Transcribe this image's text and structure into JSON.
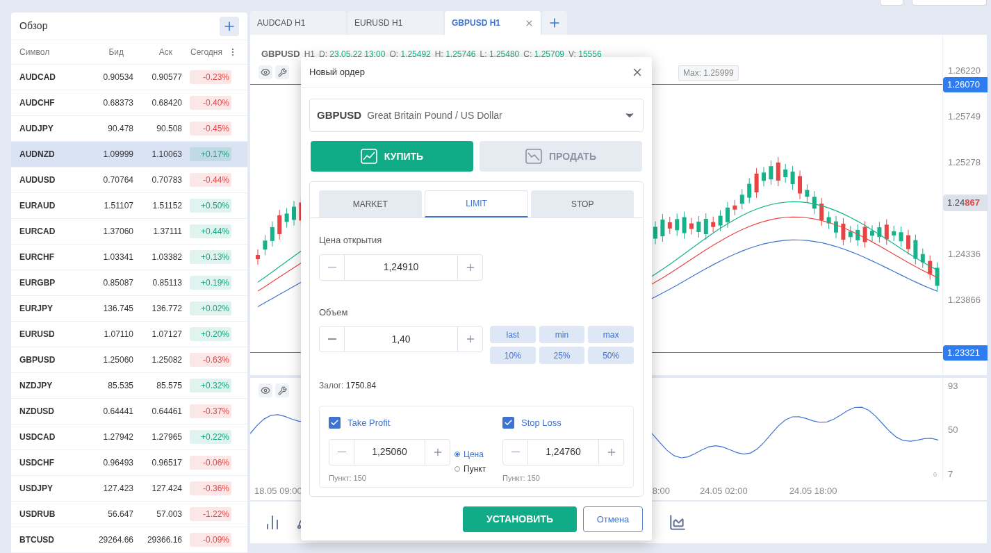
{
  "watchlist": {
    "title": "Обзор",
    "columns": [
      "Символ",
      "Бид",
      "Аск",
      "Сегодня"
    ],
    "rows": [
      {
        "symbol": "AUDCAD",
        "bid": "0.90534",
        "ask": "0.90577",
        "change": "-0.23%",
        "color": "#e24848",
        "selected": false
      },
      {
        "symbol": "AUDCHF",
        "bid": "0.68373",
        "ask": "0.68420",
        "change": "-0.40%",
        "color": "#e24848",
        "selected": false
      },
      {
        "symbol": "AUDJPY",
        "bid": "90.478",
        "ask": "90.508",
        "change": "-0.45%",
        "color": "#e24848",
        "selected": false
      },
      {
        "symbol": "AUDNZD",
        "bid": "1.09999",
        "ask": "1.10063",
        "change": "+0.17%",
        "color": "#18a57f",
        "selected": true
      },
      {
        "symbol": "AUDUSD",
        "bid": "0.70764",
        "ask": "0.70783",
        "change": "-0.44%",
        "color": "#e24848",
        "selected": false
      },
      {
        "symbol": "EURAUD",
        "bid": "1.51107",
        "ask": "1.51152",
        "change": "+0.50%",
        "color": "#18a57f",
        "selected": false
      },
      {
        "symbol": "EURCAD",
        "bid": "1.37060",
        "ask": "1.37111",
        "change": "+0.44%",
        "color": "#18a57f",
        "selected": false
      },
      {
        "symbol": "EURCHF",
        "bid": "1.03341",
        "ask": "1.03382",
        "change": "+0.13%",
        "color": "#18a57f",
        "selected": false
      },
      {
        "symbol": "EURGBP",
        "bid": "0.85087",
        "ask": "0.85113",
        "change": "+0.19%",
        "color": "#18a57f",
        "selected": false
      },
      {
        "symbol": "EURJPY",
        "bid": "136.745",
        "ask": "136.772",
        "change": "+0.02%",
        "color": "#18a57f",
        "selected": false
      },
      {
        "symbol": "EURUSD",
        "bid": "1.07110",
        "ask": "1.07127",
        "change": "+0.20%",
        "color": "#18a57f",
        "selected": false
      },
      {
        "symbol": "GBPUSD",
        "bid": "1.25060",
        "ask": "1.25082",
        "change": "-0.63%",
        "color": "#e24848",
        "selected": false
      },
      {
        "symbol": "NZDJPY",
        "bid": "85.535",
        "ask": "85.575",
        "change": "+0.32%",
        "color": "#18a57f",
        "selected": false
      },
      {
        "symbol": "NZDUSD",
        "bid": "0.64441",
        "ask": "0.64461",
        "change": "-0.37%",
        "color": "#e24848",
        "selected": false
      },
      {
        "symbol": "USDCAD",
        "bid": "1.27942",
        "ask": "1.27965",
        "change": "+0.22%",
        "color": "#18a57f",
        "selected": false
      },
      {
        "symbol": "USDCHF",
        "bid": "0.96493",
        "ask": "0.96517",
        "change": "-0.06%",
        "color": "#e24848",
        "selected": false
      },
      {
        "symbol": "USDJPY",
        "bid": "127.423",
        "ask": "127.424",
        "change": "-0.36%",
        "color": "#e24848",
        "selected": false
      },
      {
        "symbol": "USDRUB",
        "bid": "56.647",
        "ask": "57.003",
        "change": "-1.22%",
        "color": "#e24848",
        "selected": false
      },
      {
        "symbol": "BTCUSD",
        "bid": "29264.66",
        "ask": "29366.16",
        "change": "-0.09%",
        "color": "#e24848",
        "selected": false
      }
    ]
  },
  "chart_tabs": [
    {
      "label": "AUDCAD H1",
      "selected": false
    },
    {
      "label": "EURUSD H1",
      "selected": false
    },
    {
      "label": "GBPUSD H1",
      "selected": true
    }
  ],
  "chart": {
    "symbol": "GBPUSD",
    "timeframe": "H1",
    "fields": [
      {
        "label": "D:",
        "value": "23.05.22 13:00"
      },
      {
        "label": "O:",
        "value": "1.25492"
      },
      {
        "label": "H:",
        "value": "1.25746"
      },
      {
        "label": "L:",
        "value": "1.25480"
      },
      {
        "label": "C:",
        "value": "1.25709"
      },
      {
        "label": "V:",
        "value": "15556"
      }
    ],
    "max_label": "Max: 1.25999",
    "price_ticks": [
      "1.26220",
      "1.25749",
      "1.25278",
      "1.24336",
      "1.23866"
    ],
    "price_lines": [
      "1.26070",
      "1.23321"
    ],
    "current_price": {
      "prefix": "1.24",
      "highlight": "867"
    },
    "oscillator_ticks": [
      "93",
      "50",
      "7"
    ],
    "oscillator_zero": "0",
    "time_ticks": [
      "18.05 09:00",
      "8:00",
      "24.05 02:00",
      "24.05 18:00"
    ]
  },
  "dialog": {
    "title": "Новый ордер",
    "symbol": "GBPUSD",
    "symbol_name": "Great Britain Pound / US Dollar",
    "sides": [
      {
        "label": "КУПИТЬ",
        "selected": true
      },
      {
        "label": "ПРОДАТЬ",
        "selected": false
      }
    ],
    "order_types": [
      {
        "label": "MARKET",
        "selected": false
      },
      {
        "label": "LIMIT",
        "selected": true
      },
      {
        "label": "STOP",
        "selected": false
      }
    ],
    "open_price": {
      "label": "Цена открытия",
      "value": "1,24910"
    },
    "volume": {
      "label": "Объем",
      "value": "1,40",
      "presets": [
        "last",
        "min",
        "max",
        "10%",
        "25%",
        "50%"
      ]
    },
    "margin": {
      "label": "Залог:",
      "value": "1750.84"
    },
    "take_profit": {
      "label": "Take Profit",
      "checked": true,
      "value": "1,25060",
      "points": "Пункт: 150"
    },
    "stop_loss": {
      "label": "Stop Loss",
      "checked": true,
      "value": "1,24760",
      "points": "Пункт: 150"
    },
    "modes": [
      {
        "label": "Цена",
        "selected": true
      },
      {
        "label": "Пункт",
        "selected": false
      }
    ],
    "submit": "УСТАНОВИТЬ",
    "cancel": "Отмена"
  }
}
